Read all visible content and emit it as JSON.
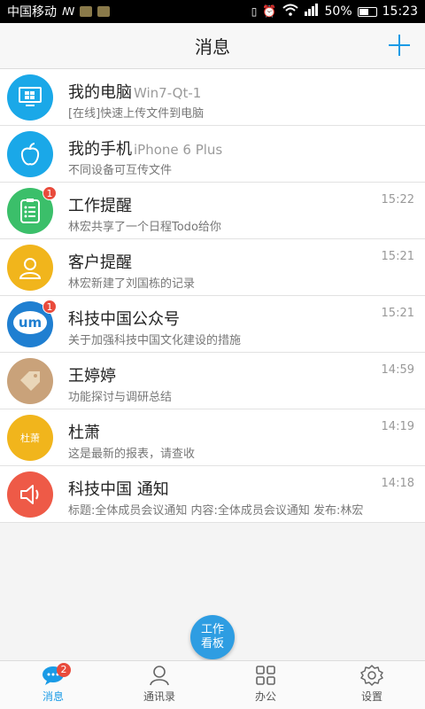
{
  "statusbar": {
    "carrier": "中国移动",
    "battery": "50%",
    "time": "15:23",
    "network": "4G"
  },
  "header": {
    "title": "消息"
  },
  "messages": [
    {
      "name": "我的电脑",
      "sub": "Win7-Qt-1",
      "msg": "[在线]快速上传文件到电脑",
      "time": "",
      "badge": "",
      "color": "#1aa8e8",
      "icon": "computer-icon"
    },
    {
      "name": "我的手机",
      "sub": "iPhone 6 Plus",
      "msg": "不同设备可互传文件",
      "time": "",
      "badge": "",
      "color": "#1aa8e8",
      "icon": "apple-icon"
    },
    {
      "name": "工作提醒",
      "sub": "",
      "msg": "林宏共享了一个日程Todo给你",
      "time": "15:22",
      "badge": "1",
      "color": "#3bbf6a",
      "icon": "checklist-icon"
    },
    {
      "name": "客户提醒",
      "sub": "",
      "msg": "林宏新建了刘国栋的记录",
      "time": "15:21",
      "badge": "",
      "color": "#f1b51c",
      "icon": "user-icon"
    },
    {
      "name": "科技中国公众号",
      "sub": "",
      "msg": "关于加强科技中国文化建设的措施",
      "time": "15:21",
      "badge": "1",
      "color": "#1f7fd1",
      "icon": "um-logo-icon"
    },
    {
      "name": "王婷婷",
      "sub": "",
      "msg": "功能探讨与调研总结",
      "time": "14:59",
      "badge": "",
      "color": "#c9a27a",
      "icon": "tag-photo-icon"
    },
    {
      "name": "杜萧",
      "sub": "",
      "msg": "这是最新的报表，请查收",
      "time": "14:19",
      "badge": "",
      "color": "#f1b51c",
      "icon": "text-avatar-icon",
      "avatar_text": "杜萧"
    },
    {
      "name": "科技中国 通知",
      "sub": "",
      "msg": "标题:全体成员会议通知 内容:全体成员会议通知 发布:林宏",
      "time": "14:18",
      "badge": "",
      "color": "#ee5a47",
      "icon": "speaker-icon"
    }
  ],
  "fab": {
    "line1": "工作",
    "line2": "看板"
  },
  "tabs": [
    {
      "label": "消息",
      "badge": "2",
      "icon": "chat-icon"
    },
    {
      "label": "通讯录",
      "icon": "contacts-icon"
    },
    {
      "label": "办公",
      "icon": "grid-icon"
    },
    {
      "label": "设置",
      "icon": "gear-icon"
    }
  ]
}
